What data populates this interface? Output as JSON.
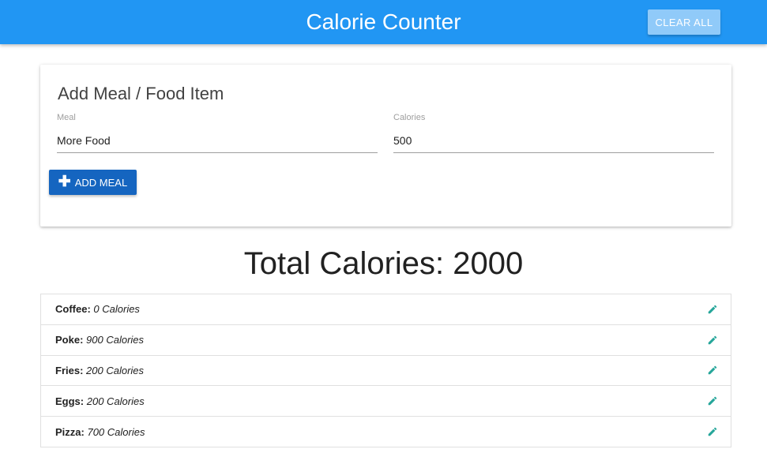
{
  "navbar": {
    "title": "Calorie Counter",
    "clear_label": "CLEAR ALL"
  },
  "form": {
    "title": "Add Meal / Food Item",
    "meal_label": "Meal",
    "meal_value": "More Food",
    "calories_label": "Calories",
    "calories_value": "500",
    "add_icon": "plus-icon",
    "add_label": "ADD MEAL"
  },
  "total": {
    "text": "Total Calories: 2000"
  },
  "items": [
    {
      "name": "Coffee:",
      "calories": "0 Calories",
      "icon": "pencil-icon"
    },
    {
      "name": "Poke:",
      "calories": "900 Calories",
      "icon": "pencil-icon"
    },
    {
      "name": "Fries:",
      "calories": "200 Calories",
      "icon": "pencil-icon"
    },
    {
      "name": "Eggs:",
      "calories": "200 Calories",
      "icon": "pencil-icon"
    },
    {
      "name": "Pizza:",
      "calories": "700 Calories",
      "icon": "pencil-icon"
    }
  ],
  "colors": {
    "navbar": "#2196f3",
    "clear_button": "#90caf9",
    "add_button": "#1565c0",
    "edit_icon": "#26a69a"
  }
}
